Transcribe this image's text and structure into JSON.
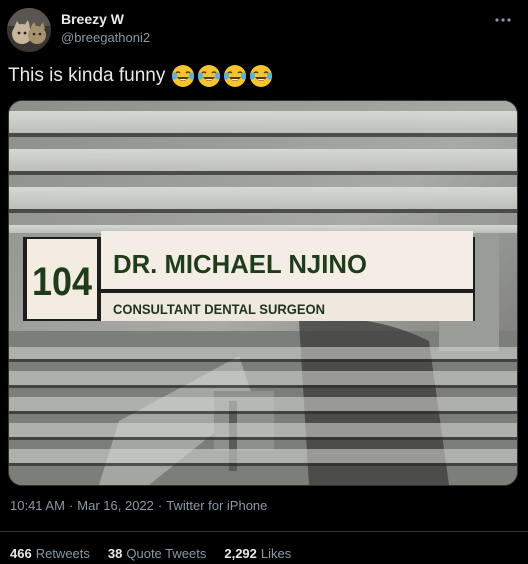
{
  "author": {
    "display_name": "Breezy W",
    "handle": "@breegathoni2"
  },
  "tweet": {
    "text": "This is kinda funny",
    "emoji": "face-with-tears-of-joy",
    "emoji_count": 4
  },
  "photo": {
    "sign_number": "104",
    "sign_name": "DR. MICHAEL NJINO",
    "sign_title": "CONSULTANT DENTAL SURGEON"
  },
  "meta": {
    "time": "10:41 AM",
    "separator": "·",
    "date": "Mar 16, 2022",
    "source": "Twitter for iPhone"
  },
  "stats": [
    {
      "count": "466",
      "label": "Retweets"
    },
    {
      "count": "38",
      "label": "Quote Tweets"
    },
    {
      "count": "2,292",
      "label": "Likes"
    }
  ],
  "colors": {
    "background": "#000000",
    "text_primary": "#e7e9ea",
    "text_secondary": "#8b98a5",
    "divider": "#2f3336",
    "sign_green": "#1e3d1b"
  }
}
